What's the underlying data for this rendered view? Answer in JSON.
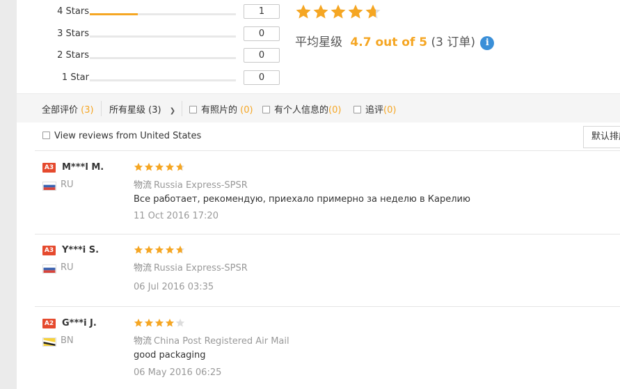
{
  "distribution": [
    {
      "label": "4 Stars",
      "count": "1",
      "fill_fraction": 0.33
    },
    {
      "label": "3 Stars",
      "count": "0",
      "fill_fraction": 0
    },
    {
      "label": "2 Stars",
      "count": "0",
      "fill_fraction": 0
    },
    {
      "label": "1 Star",
      "count": "0",
      "fill_fraction": 0
    }
  ],
  "summary": {
    "rating_fraction": 0.94,
    "avg_label": "平均星级",
    "avg_value": "4.7 out of 5",
    "orders_text": "(3 订单)",
    "info_icon": "i"
  },
  "filters": {
    "all_label": "全部评价",
    "all_count": "(3)",
    "stars_label": "所有星级",
    "stars_count": "(3)",
    "photos_label": "有照片的",
    "photos_count": "(0)",
    "personal_label": "有个人信息的",
    "personal_count": "(0)",
    "followup_label": "追评",
    "followup_count": "(0)",
    "us_label": "View reviews from United States",
    "sort_label": "默认排序"
  },
  "reviews": [
    {
      "badge": "A3",
      "name": "M***l M.",
      "country": "RU",
      "rating_fraction": 0.94,
      "logistics_label": "物流",
      "logistics": "Russia Express-SPSR",
      "feedback": "Все работает, рекомендую, приехало примерно за неделю в Карелию",
      "date": "11 Oct 2016 17:20"
    },
    {
      "badge": "A3",
      "name": "Y***i S.",
      "country": "RU",
      "rating_fraction": 0.94,
      "logistics_label": "物流",
      "logistics": "Russia Express-SPSR",
      "feedback": "",
      "date": "06 Jul 2016 03:35"
    },
    {
      "badge": "A2",
      "name": "G***i J.",
      "country": "BN",
      "rating_fraction": 0.8,
      "logistics_label": "物流",
      "logistics": "China Post Registered Air Mail",
      "feedback": "good packaging",
      "date": "06 May 2016 06:25"
    }
  ],
  "colors": {
    "accent": "#f5a623",
    "star_empty": "#dddddd",
    "badge": "#e54a2e",
    "info": "#3a8fd8"
  }
}
